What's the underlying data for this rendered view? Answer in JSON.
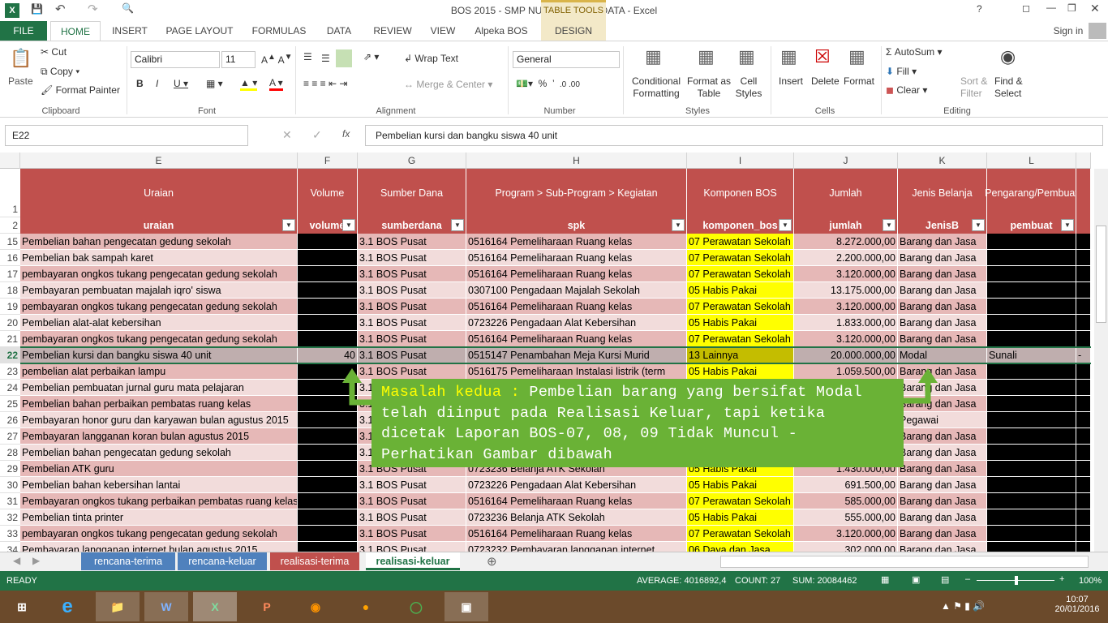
{
  "window": {
    "title": "BOS 2015 - SMP NURUL JADID - DATA - Excel",
    "table_tools": "TABLE TOOLS",
    "help": "?",
    "sign_in": "Sign in"
  },
  "tabs": [
    "FILE",
    "HOME",
    "INSERT",
    "PAGE LAYOUT",
    "FORMULAS",
    "DATA",
    "REVIEW",
    "VIEW",
    "Alpeka BOS",
    "DESIGN"
  ],
  "ribbon": {
    "clipboard": {
      "label": "Clipboard",
      "paste": "Paste",
      "cut": "Cut",
      "copy": "Copy",
      "format_painter": "Format Painter"
    },
    "font": {
      "label": "Font",
      "name": "Calibri",
      "size": "11"
    },
    "alignment": {
      "label": "Alignment",
      "wrap": "Wrap Text",
      "merge": "Merge & Center"
    },
    "number": {
      "label": "Number",
      "format": "General"
    },
    "styles": {
      "label": "Styles",
      "conditional": "Conditional Formatting",
      "format_table": "Format as Table",
      "cell_styles": "Cell Styles"
    },
    "cells": {
      "label": "Cells",
      "insert": "Insert",
      "delete": "Delete",
      "format": "Format"
    },
    "editing": {
      "label": "Editing",
      "autosum": "AutoSum",
      "fill": "Fill",
      "clear": "Clear",
      "sort": "Sort & Filter",
      "find": "Find & Select"
    }
  },
  "formula_bar": {
    "name_box": "E22",
    "fx": "fx",
    "value": "Pembelian kursi dan bangku siswa 40 unit"
  },
  "columns": [
    "E",
    "F",
    "G",
    "H",
    "I",
    "J",
    "K",
    "L"
  ],
  "headers_row1": [
    "Uraian",
    "Volume",
    "Sumber Dana",
    "Program > Sub-Program > Kegiatan",
    "Komponen BOS",
    "Jumlah",
    "Jenis Belanja",
    "Pengarang/Pembuat"
  ],
  "headers_row2": [
    "uraian",
    "volume",
    "sumberdana",
    "spk",
    "komponen_bos",
    "jumlah",
    "JenisB",
    "pembuat"
  ],
  "rows": [
    {
      "n": "15",
      "e": "Pembelian bahan pengecatan gedung sekolah",
      "f": "",
      "g": "3.1 BOS Pusat",
      "h": "0516164 Pemeliharaan Ruang kelas",
      "i": "07 Perawatan Sekolah",
      "j": "8.272.000,00",
      "k": "Barang dan Jasa"
    },
    {
      "n": "16",
      "e": "Pembelian bak sampah karet",
      "f": "",
      "g": "3.1 BOS Pusat",
      "h": "0516164 Pemeliharaan Ruang kelas",
      "i": "07 Perawatan Sekolah",
      "j": "2.200.000,00",
      "k": "Barang dan Jasa"
    },
    {
      "n": "17",
      "e": "pembayaran ongkos tukang pengecatan gedung sekolah",
      "f": "",
      "g": "3.1 BOS Pusat",
      "h": "0516164 Pemeliharaan Ruang kelas",
      "i": "07 Perawatan Sekolah",
      "j": "3.120.000,00",
      "k": "Barang dan Jasa"
    },
    {
      "n": "18",
      "e": "Pembayaran pembuatan majalah iqro' siswa",
      "f": "",
      "g": "3.1 BOS Pusat",
      "h": "0307100 Pengadaan Majalah Sekolah",
      "i": "05 Habis Pakai",
      "j": "13.175.000,00",
      "k": "Barang dan Jasa"
    },
    {
      "n": "19",
      "e": "pembayaran ongkos tukang pengecatan gedung sekolah",
      "f": "",
      "g": "3.1 BOS Pusat",
      "h": "0516164 Pemeliharaan Ruang kelas",
      "i": "07 Perawatan Sekolah",
      "j": "3.120.000,00",
      "k": "Barang dan Jasa"
    },
    {
      "n": "20",
      "e": "Pembelian alat-alat kebersihan",
      "f": "",
      "g": "3.1 BOS Pusat",
      "h": "0723226 Pengadaan Alat Kebersihan",
      "i": "05 Habis Pakai",
      "j": "1.833.000,00",
      "k": "Barang dan Jasa"
    },
    {
      "n": "21",
      "e": "pembayaran ongkos tukang pengecatan gedung sekolah",
      "f": "",
      "g": "3.1 BOS Pusat",
      "h": "0516164 Pemeliharaan Ruang kelas",
      "i": "07 Perawatan Sekolah",
      "j": "3.120.000,00",
      "k": "Barang dan Jasa"
    },
    {
      "n": "22",
      "e": "Pembelian kursi dan bangku siswa 40 unit",
      "f": "40",
      "g": "3.1 BOS Pusat",
      "h": "0515147 Penambahan Meja Kursi Murid",
      "i": "13 Lainnya",
      "j": "20.000.000,00",
      "k": "Modal",
      "l": "Sunali",
      "m": "-",
      "selected": true
    },
    {
      "n": "23",
      "e": "pembelian alat perbaikan lampu",
      "f": "",
      "g": "3.1 BOS Pusat",
      "h": "0516175 Pemeliharaan Instalasi listrik (term",
      "i": "05 Habis Pakai",
      "j": "1.059.500,00",
      "k": "Barang dan Jasa"
    },
    {
      "n": "24",
      "e": "Pembelian pembuatan jurnal guru mata pelajaran",
      "f": "",
      "g": "3.1 BOS Pusat",
      "h": "",
      "i": "",
      "j": "",
      "k": "Barang dan Jasa"
    },
    {
      "n": "25",
      "e": "Pembelian bahan perbaikan pembatas ruang kelas",
      "f": "",
      "g": "3.1 BOS Pusat",
      "h": "",
      "i": "",
      "j": "",
      "k": "Barang dan Jasa"
    },
    {
      "n": "26",
      "e": "Pembayaran honor guru dan karyawan bulan agustus 2015",
      "f": "",
      "g": "3.1 BOS Pusat",
      "h": "",
      "i": "",
      "j": "",
      "k": "Pegawai"
    },
    {
      "n": "27",
      "e": "Pembayaran langganan koran bulan agustus 2015",
      "f": "",
      "g": "3.1 BOS Pusat",
      "h": "",
      "i": "",
      "j": "",
      "k": "Barang dan Jasa"
    },
    {
      "n": "28",
      "e": "Pembelian bahan pengecatan gedung sekolah",
      "f": "",
      "g": "3.1 BOS Pusat",
      "h": "",
      "i": "",
      "j": "",
      "k": "Barang dan Jasa"
    },
    {
      "n": "29",
      "e": "Pembelian ATK guru",
      "f": "",
      "g": "3.1 BOS Pusat",
      "h": "0723236 Belanja ATK Sekolah",
      "i": "05 Habis Pakai",
      "j": "1.430.000,00",
      "k": "Barang dan Jasa"
    },
    {
      "n": "30",
      "e": "Pembelian bahan kebersihan lantai",
      "f": "",
      "g": "3.1 BOS Pusat",
      "h": "0723226 Pengadaan Alat Kebersihan",
      "i": "05 Habis Pakai",
      "j": "691.500,00",
      "k": "Barang dan Jasa"
    },
    {
      "n": "31",
      "e": "Pembayaran ongkos tukang perbaikan pembatas ruang kelas",
      "f": "",
      "g": "3.1 BOS Pusat",
      "h": "0516164 Pemeliharaan Ruang kelas",
      "i": "07 Perawatan Sekolah",
      "j": "585.000,00",
      "k": "Barang dan Jasa"
    },
    {
      "n": "32",
      "e": "Pembelian tinta printer",
      "f": "",
      "g": "3.1 BOS Pusat",
      "h": "0723236 Belanja ATK Sekolah",
      "i": "05 Habis Pakai",
      "j": "555.000,00",
      "k": "Barang dan Jasa"
    },
    {
      "n": "33",
      "e": "pembayaran ongkos tukang pengecatan gedung sekolah",
      "f": "",
      "g": "3.1 BOS Pusat",
      "h": "0516164 Pemeliharaan Ruang kelas",
      "i": "07 Perawatan Sekolah",
      "j": "3.120.000,00",
      "k": "Barang dan Jasa"
    },
    {
      "n": "34",
      "e": "Pembayaran langganan internet bulan agustus 2015",
      "f": "",
      "g": "3.1 BOS Pusat",
      "h": "0723232 Pembayaran langganan internet",
      "i": "06 Daya dan Jasa",
      "j": "302.000,00",
      "k": "Barang dan Jasa"
    }
  ],
  "callout": {
    "highlight": "Masalah kedua :",
    "text": " Pembelian barang yang bersifat Modal telah diinput pada Realisasi Keluar, tapi ketika dicetak Laporan BOS-07, 08, 09 Tidak Muncul - Perhatikan Gambar dibawah"
  },
  "sheets": [
    {
      "name": "rencana-terima",
      "color": "#4f81bd"
    },
    {
      "name": "rencana-keluar",
      "color": "#4f81bd"
    },
    {
      "name": "realisasi-terima",
      "color": "#c0504d"
    },
    {
      "name": "realisasi-keluar",
      "color": "#ffffff",
      "active": true
    }
  ],
  "status": {
    "mode": "READY",
    "average": "AVERAGE: 4016892,4",
    "count": "COUNT: 27",
    "sum": "SUM: 20084462",
    "zoom": "100%",
    "zoom_percent": 100
  },
  "taskbar": {
    "time": "10:07",
    "date": "20/01/2016"
  },
  "colors": {
    "excel_green": "#217346",
    "header_red": "#c0504d",
    "row_dark": "#e6b8b7",
    "row_light": "#f2dcdb",
    "yellow": "#ffff00",
    "callout": "#6ab236",
    "callout_highlight": "#ffff00"
  }
}
